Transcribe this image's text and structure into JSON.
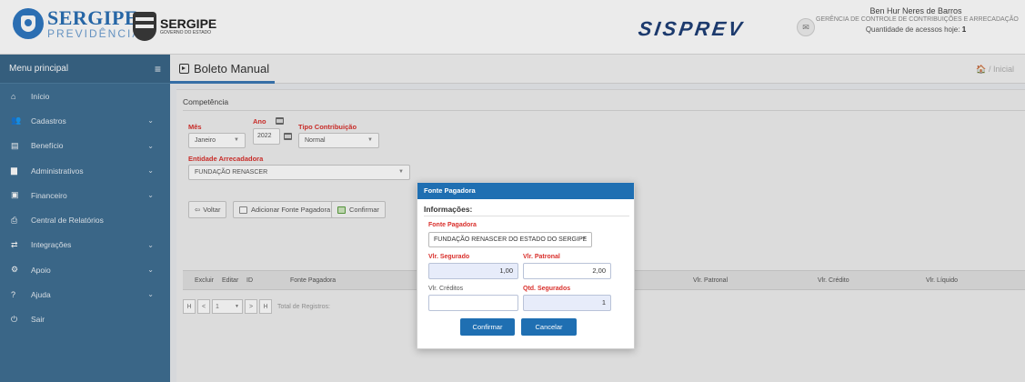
{
  "header": {
    "logo_main": "SERGIPE",
    "logo_sub": "PREVIDÊNCIA",
    "gov_main": "SERGIPE",
    "gov_sub": "GOVERNO DO ESTADO",
    "app_name": "SISPREV",
    "user_name": "Ben Hur Neres de Barros",
    "user_department": "GERÊNCIA DE CONTROLE DE CONTRIBUIÇÕES E ARRECADAÇÃO",
    "access_label": "Quantidade de acessos hoje:",
    "access_count": "1"
  },
  "sidebar": {
    "title": "Menu principal",
    "items": [
      {
        "label": "Início",
        "icon": "home-icon",
        "expandable": false
      },
      {
        "label": "Cadastros",
        "icon": "users-icon",
        "expandable": true
      },
      {
        "label": "Benefício",
        "icon": "document-icon",
        "expandable": true
      },
      {
        "label": "Administrativos",
        "icon": "folder-icon",
        "expandable": true
      },
      {
        "label": "Financeiro",
        "icon": "money-icon",
        "expandable": true
      },
      {
        "label": "Central de Relatórios",
        "icon": "printer-icon",
        "expandable": false
      },
      {
        "label": "Integrações",
        "icon": "transfer-icon",
        "expandable": true
      },
      {
        "label": "Apoio",
        "icon": "gear-icon",
        "expandable": true
      },
      {
        "label": "Ajuda",
        "icon": "help-icon",
        "expandable": true
      },
      {
        "label": "Sair",
        "icon": "power-icon",
        "expandable": false
      }
    ]
  },
  "page": {
    "title": "Boleto Manual",
    "breadcrumb_home": "🏠",
    "breadcrumb": "/ Inicial"
  },
  "form": {
    "section_title": "Competência",
    "mes_label": "Mês",
    "mes_value": "Janeiro",
    "ano_label": "Ano",
    "ano_value": "2022",
    "tipo_label": "Tipo Contribuição",
    "tipo_value": "Normal",
    "entidade_label": "Entidade Arrecadadora",
    "entidade_value": "FUNDAÇÃO RENASCER"
  },
  "toolbar": {
    "voltar": "Voltar",
    "adicionar": "Adicionar Fonte Pagadora",
    "confirmar": "Confirmar"
  },
  "table": {
    "columns": [
      "Excluir",
      "Editar",
      "ID",
      "Fonte Pagadora",
      "Vlr. Patronal",
      "Vlr. Crédito",
      "Vlr. Líquido"
    ]
  },
  "pager": {
    "first": "H",
    "prev": "<",
    "page": "1",
    "next": ">",
    "last": "H",
    "total_label": "Total de Registros:"
  },
  "modal": {
    "title": "Fonte Pagadora",
    "subtitle": "Informações:",
    "fonte_label": "Fonte Pagadora",
    "fonte_value": "FUNDAÇÃO RENASCER DO ESTADO DO SERGIPE",
    "segurado_label": "Vlr. Segurado",
    "segurado_value": "1,00",
    "patronal_label": "Vlr. Patronal",
    "patronal_value": "2,00",
    "creditos_label": "Vlr. Créditos",
    "creditos_value": "",
    "qtd_label": "Qtd. Segurados",
    "qtd_value": "1",
    "confirm": "Confirmar",
    "cancel": "Cancelar"
  },
  "colors": {
    "sidebar": "#3f6f93",
    "primary": "#1f6fb2",
    "required_label": "#d9302c"
  }
}
